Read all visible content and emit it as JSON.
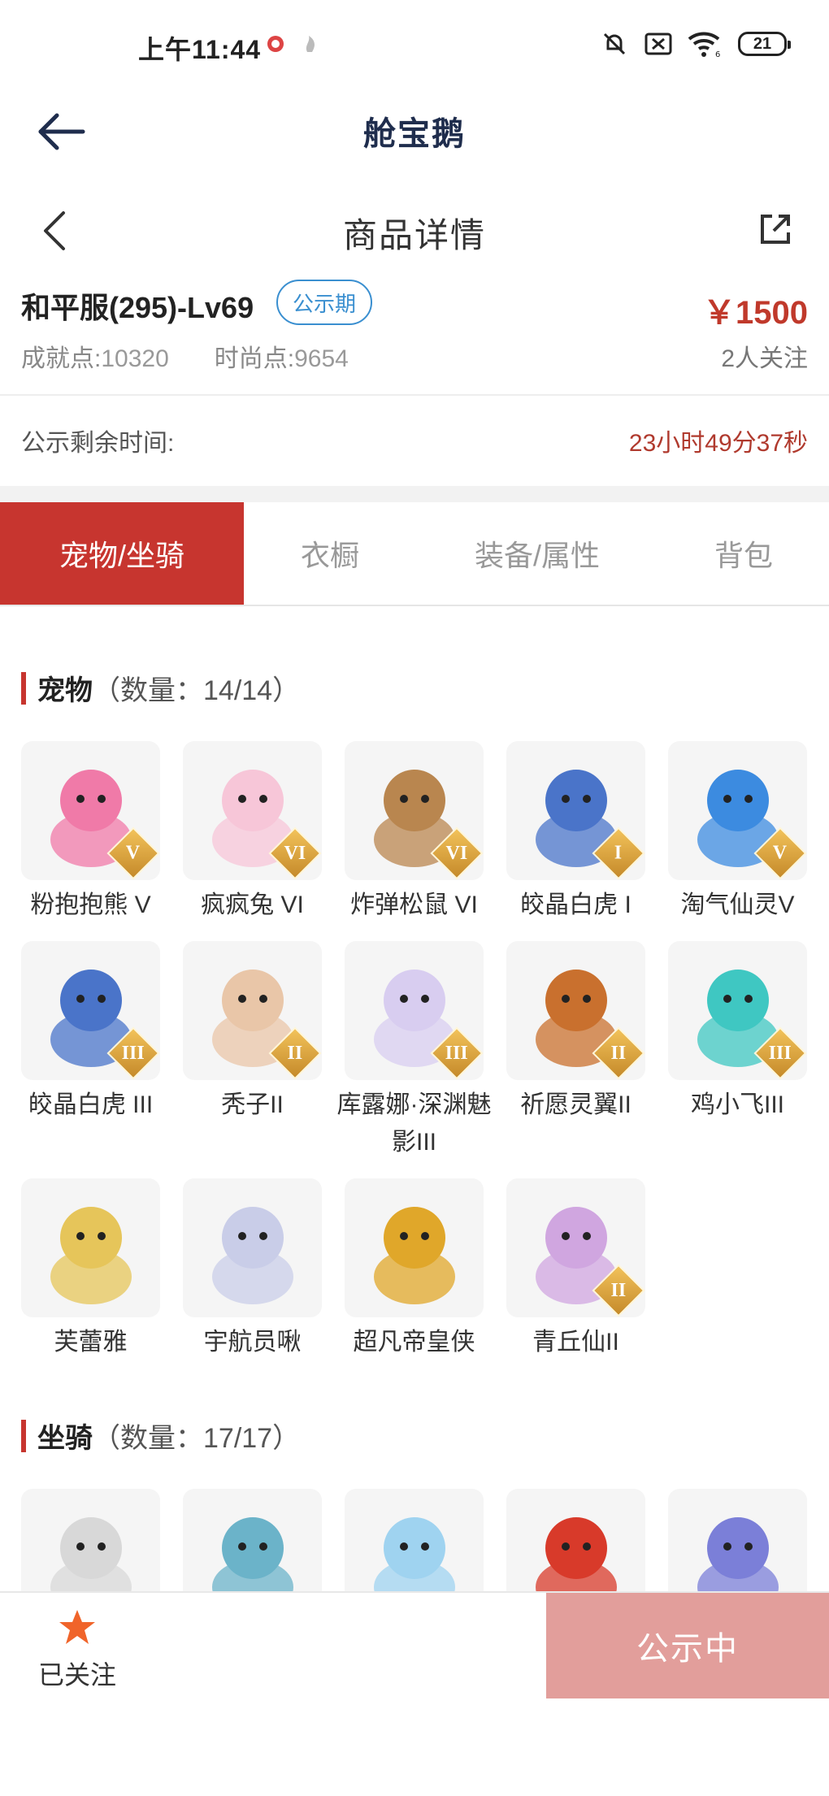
{
  "status_bar": {
    "time": "上午11:44",
    "battery": "21",
    "wifi_badge": "6"
  },
  "app": {
    "title": "舱宝鹅"
  },
  "detail": {
    "title": "商品详情"
  },
  "product": {
    "name": "和平服(295)-Lv69",
    "tag": "公示期",
    "price": "￥1500",
    "achievement_label": "成就点:",
    "achievement_value": "10320",
    "fashion_label": "时尚点:",
    "fashion_value": "9654",
    "followers": "2人关注"
  },
  "countdown": {
    "label": "公示剩余时间:",
    "value": "23小时49分37秒"
  },
  "tabs": [
    {
      "label": "宠物/坐骑",
      "active": true
    },
    {
      "label": "衣橱",
      "active": false
    },
    {
      "label": "装备/属性",
      "active": false
    },
    {
      "label": "背包",
      "active": false
    }
  ],
  "pets_section": {
    "title": "宠物",
    "count": "（数量：14/14）"
  },
  "pets": [
    {
      "name": "粉抱抱熊 V",
      "rank": "V",
      "icon": "pink-bear-icon",
      "color": "#f07aa8"
    },
    {
      "name": "疯疯兔 VI",
      "rank": "VI",
      "icon": "crazy-rabbit-icon",
      "color": "#f7c6d8"
    },
    {
      "name": "炸弹松鼠 VI",
      "rank": "VI",
      "icon": "bomb-squirrel-icon",
      "color": "#b9864f"
    },
    {
      "name": "皎晶白虎 I",
      "rank": "I",
      "icon": "crystal-tiger-icon",
      "color": "#4a74c9"
    },
    {
      "name": "淘气仙灵V",
      "rank": "V",
      "icon": "naughty-sprite-icon",
      "color": "#3c8be0"
    },
    {
      "name": "皎晶白虎 III",
      "rank": "III",
      "icon": "crystal-tiger-icon",
      "color": "#4a74c9"
    },
    {
      "name": "秃子II",
      "rank": "II",
      "icon": "bald-kid-icon",
      "color": "#e9c6a8"
    },
    {
      "name": "库露娜·深渊魅影III",
      "rank": "III",
      "icon": "kuluna-icon",
      "color": "#d8cdf0"
    },
    {
      "name": "祈愿灵翼II",
      "rank": "II",
      "icon": "wish-wing-icon",
      "color": "#c9702e"
    },
    {
      "name": "鸡小飞III",
      "rank": "III",
      "icon": "chick-flyer-icon",
      "color": "#3fc7c2"
    },
    {
      "name": "芙蕾雅",
      "rank": "",
      "icon": "freya-icon",
      "color": "#e6c55a"
    },
    {
      "name": "宇航员啾",
      "rank": "",
      "icon": "astronaut-icon",
      "color": "#c9cde8"
    },
    {
      "name": "超凡帝皇侠",
      "rank": "",
      "icon": "emperor-hero-icon",
      "color": "#e0a72a"
    },
    {
      "name": "青丘仙II",
      "rank": "II",
      "icon": "qingqiu-fox-icon",
      "color": "#d0a6e0"
    }
  ],
  "mounts_section": {
    "title": "坐骑",
    "count": "（数量：17/17）"
  },
  "mounts": [
    {
      "icon": "white-dragon-mount-icon",
      "color": "#d8d8d8"
    },
    {
      "icon": "blue-dragon-mount-icon",
      "color": "#6bb3c9"
    },
    {
      "icon": "cloud-mount-icon",
      "color": "#9fd3f0"
    },
    {
      "icon": "drum-mount-icon",
      "color": "#d83a2a"
    },
    {
      "icon": "spirit-mount-icon",
      "color": "#7b7fd8"
    }
  ],
  "bottom": {
    "follow_label": "已关注",
    "cta_label": "公示中"
  },
  "colors": {
    "accent": "#c7352f",
    "price": "#c0392b",
    "tag_blue": "#3a8fd0",
    "cta": "#e29e9b",
    "star": "#f0642a"
  }
}
